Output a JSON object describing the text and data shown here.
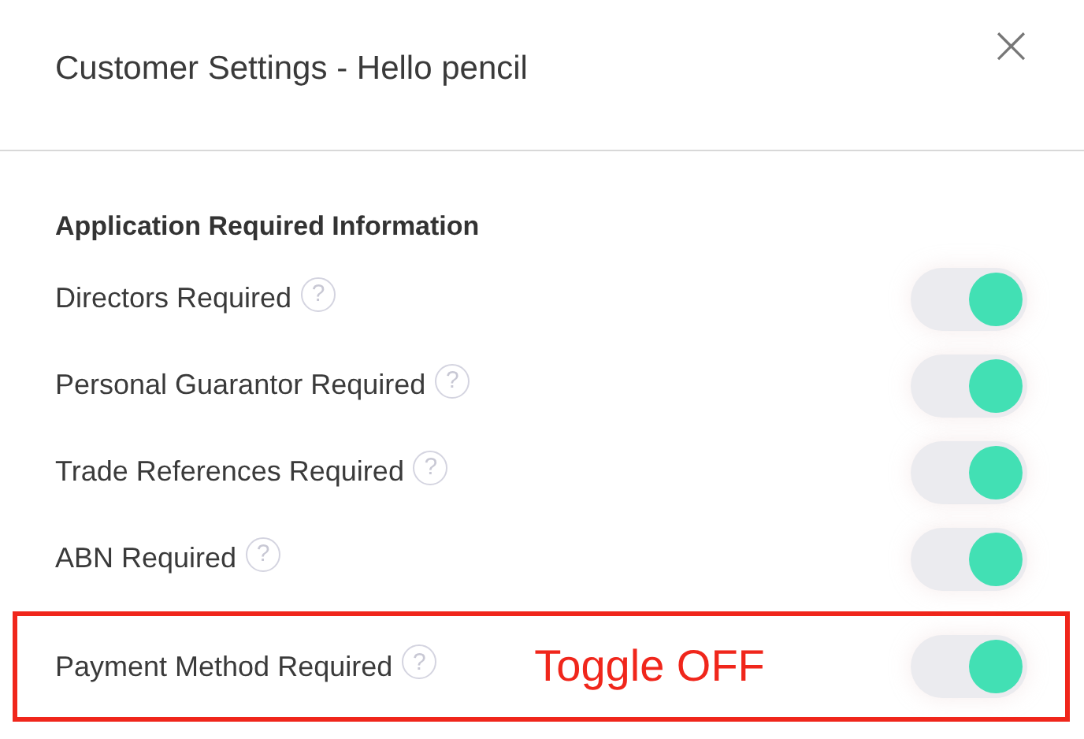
{
  "dialog": {
    "title": "Customer Settings - Hello pencil",
    "close": "×"
  },
  "section": {
    "heading": "Application Required Information"
  },
  "rows": [
    {
      "label": "Directors Required",
      "help": "?",
      "on": true,
      "highlighted": false
    },
    {
      "label": "Personal Guarantor Required",
      "help": "?",
      "on": true,
      "highlighted": false
    },
    {
      "label": "Trade References Required",
      "help": "?",
      "on": true,
      "highlighted": false
    },
    {
      "label": "ABN Required",
      "help": "?",
      "on": true,
      "highlighted": false
    },
    {
      "label": "Payment Method Required",
      "help": "?",
      "on": true,
      "highlighted": true,
      "note": "Toggle OFF"
    }
  ]
}
